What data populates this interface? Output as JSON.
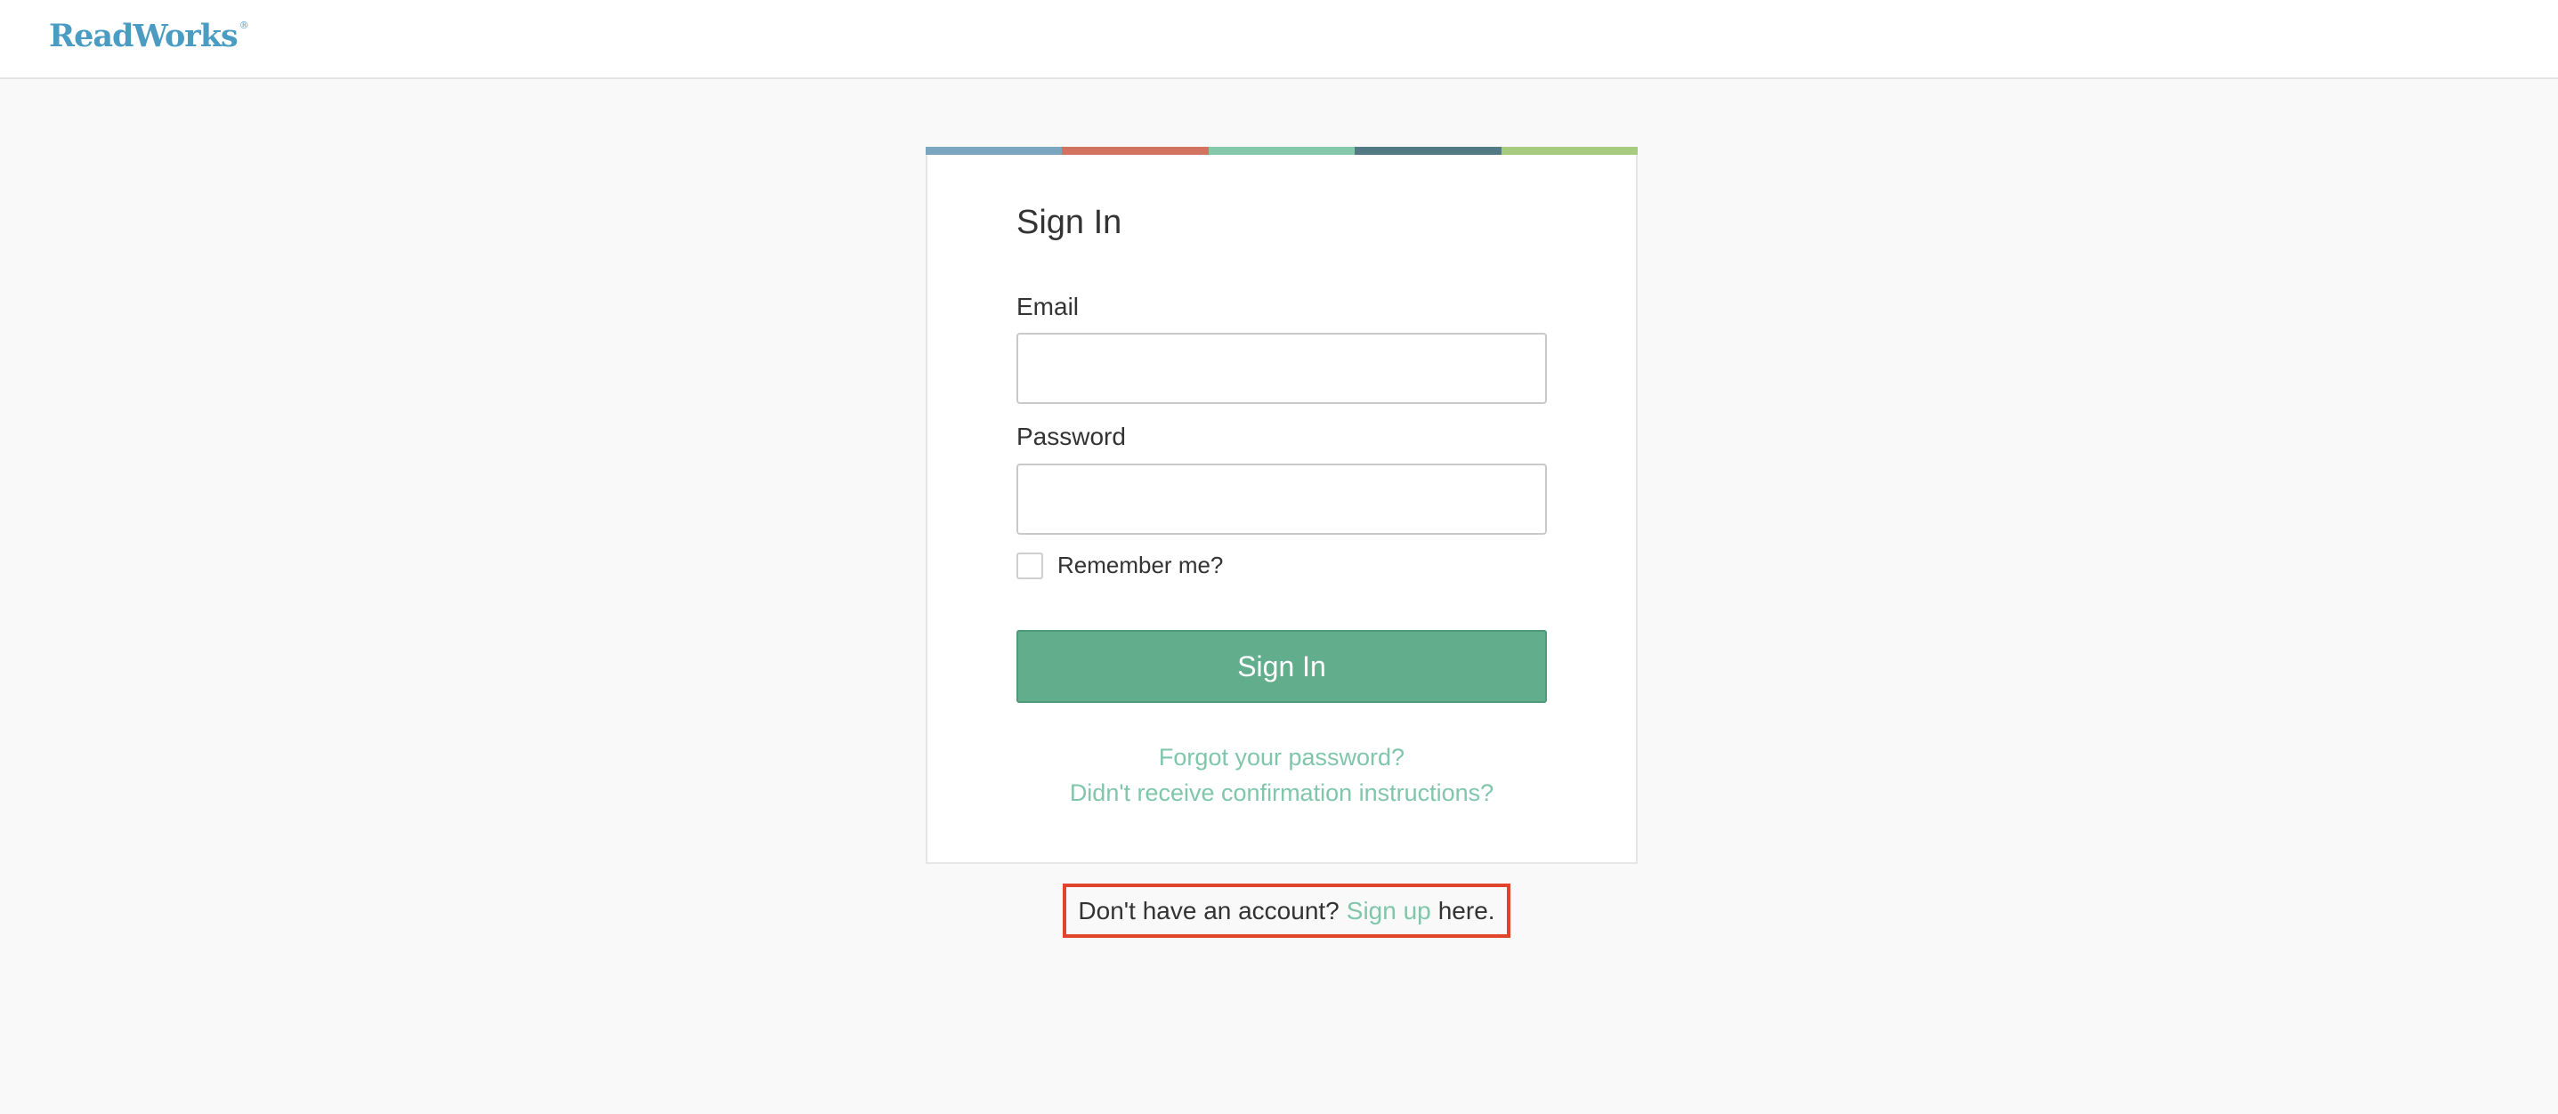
{
  "header": {
    "logo_text": "ReadWorks",
    "logo_mark": "®"
  },
  "colors": {
    "brand_blue": "#4a9cc3",
    "primary_green": "#62ae8c",
    "link_green": "#7fc6ab",
    "highlight_red": "#e0452a",
    "stripe": [
      "#7aa7bf",
      "#d2735f",
      "#85c9ab",
      "#517a85",
      "#a8cc7f"
    ]
  },
  "signin": {
    "title": "Sign In",
    "email_label": "Email",
    "email_value": "",
    "password_label": "Password",
    "password_value": "",
    "remember_label": "Remember me?",
    "remember_checked": false,
    "button_label": "Sign In",
    "forgot_link": "Forgot your password?",
    "confirm_link": "Didn't receive confirmation instructions?"
  },
  "signup": {
    "prefix": "Don't have an account?",
    "link": "Sign up",
    "suffix": "here."
  }
}
